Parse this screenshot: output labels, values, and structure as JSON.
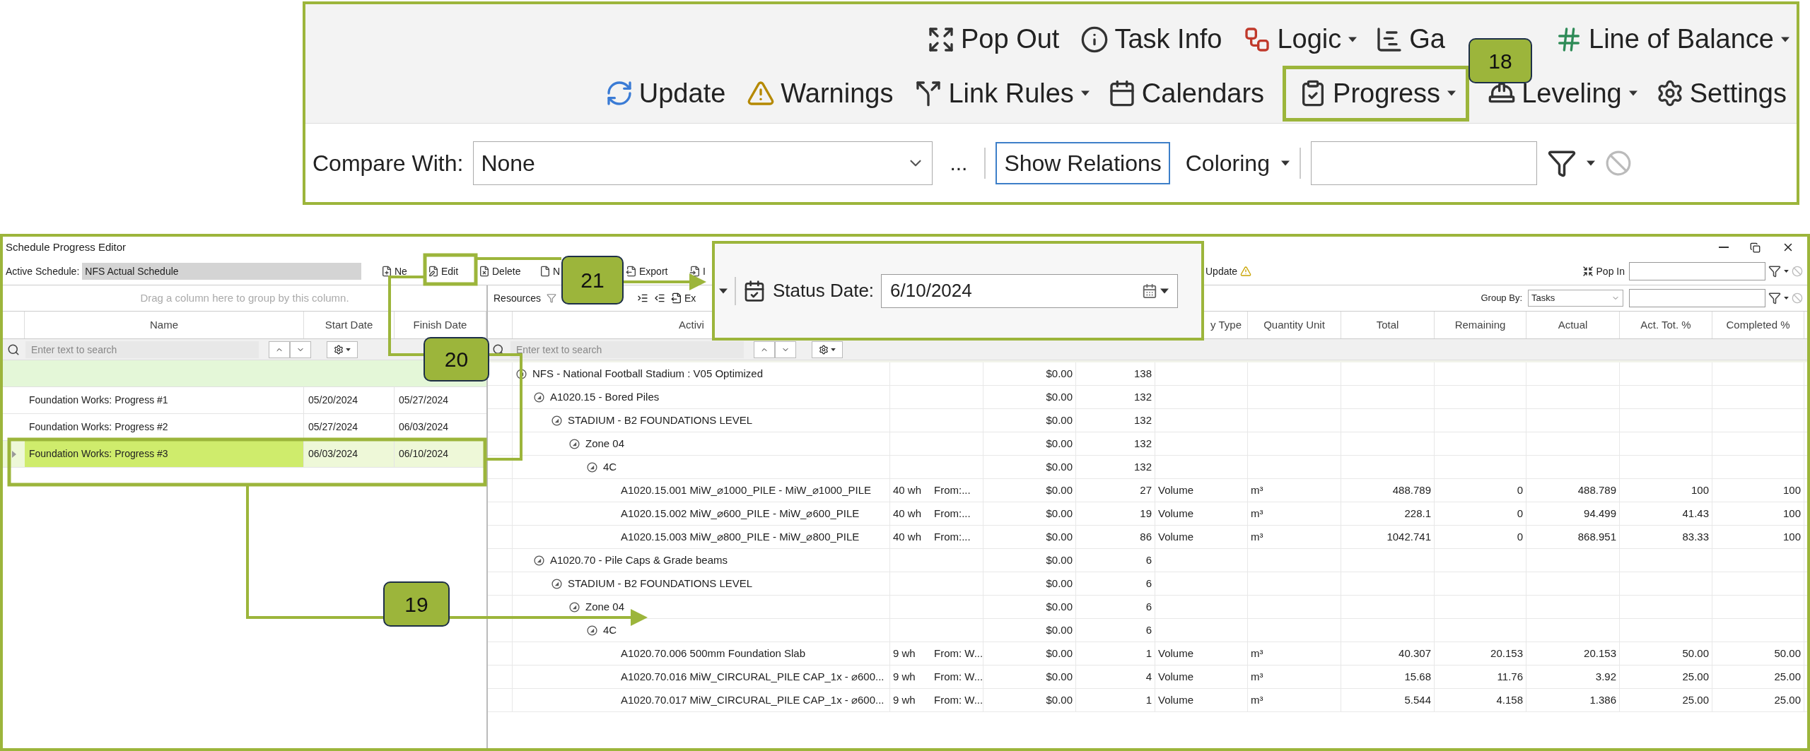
{
  "ribbon": {
    "row_1": [
      {
        "label": "Pop Out",
        "dropdown": false
      },
      {
        "label": "Task Info",
        "dropdown": false
      },
      {
        "label": "Logic",
        "dropdown": true
      },
      {
        "label": "Ga",
        "dropdown": false
      },
      {
        "label": "Line of Balance",
        "dropdown": true
      }
    ],
    "row_2": [
      {
        "label": "Update",
        "dropdown": false
      },
      {
        "label": "Warnings",
        "dropdown": false
      },
      {
        "label": "Link Rules",
        "dropdown": true
      },
      {
        "label": "Calendars",
        "dropdown": false
      },
      {
        "label": "Progress",
        "dropdown": true
      },
      {
        "label": "Leveling",
        "dropdown": true
      },
      {
        "label": "Settings",
        "dropdown": false
      }
    ],
    "compare_with": {
      "label": "Compare With:",
      "value": "None"
    },
    "more_button": "...",
    "show_relations_button": "Show Relations",
    "coloring_button": "Coloring"
  },
  "editor": {
    "title": "Schedule Progress Editor",
    "active_schedule": {
      "label": "Active Schedule:",
      "value": "NFS Actual Schedule"
    },
    "toolbar": [
      {
        "label": "Ne"
      },
      {
        "label": "Edit"
      },
      {
        "label": "Delete"
      },
      {
        "label": "N"
      },
      {
        "label": "Export"
      },
      {
        "label": "I"
      }
    ],
    "update_button": "Update",
    "pop_in_button": "Pop In"
  },
  "progress_list": {
    "group_hint": "Drag a column here to group by this column.",
    "columns": [
      "Name",
      "Start Date",
      "Finish Date"
    ],
    "search": {
      "placeholder": "Enter text to search"
    },
    "rows": [
      {
        "name": "Foundation Works: Progress #1",
        "start": "05/20/2024",
        "finish": "05/27/2024",
        "selected": false
      },
      {
        "name": "Foundation Works: Progress #2",
        "start": "05/27/2024",
        "finish": "06/03/2024",
        "selected": false
      },
      {
        "name": "Foundation Works: Progress #3",
        "start": "06/03/2024",
        "finish": "06/10/2024",
        "selected": true
      }
    ]
  },
  "activities": {
    "toolbar": {
      "resources": "Resources",
      "export": "Ex",
      "group_by": {
        "label": "Group By:",
        "value": "Tasks"
      }
    },
    "columns": {
      "activity": "Activi",
      "type": "y Type",
      "rest": [
        "Quantity Unit",
        "Total",
        "Remaining",
        "Actual",
        "Act. Tot. %",
        "Completed %"
      ]
    },
    "search": {
      "placeholder": "Enter text to search"
    },
    "rows": [
      {
        "name": "NFS - National Football Stadium : V05 Optimized",
        "cost": "$0.00",
        "count": "138",
        "expanded": true,
        "children": [
          {
            "name": "A1020.15 - Bored Piles",
            "cost": "$0.00",
            "count": "132",
            "expanded": true,
            "children": [
              {
                "name": "STADIUM - B2 FOUNDATIONS LEVEL",
                "cost": "$0.00",
                "count": "132",
                "expanded": true,
                "children": [
                  {
                    "name": "Zone 04",
                    "cost": "$0.00",
                    "count": "132",
                    "expanded": true,
                    "children": [
                      {
                        "name": "4C",
                        "cost": "$0.00",
                        "count": "132",
                        "expanded": true,
                        "children": [
                          {
                            "name": "A1020.15.001 MiW_⌀1000_PILE - MiW_⌀1000_PILE",
                            "work": "40 wh",
                            "from": "From:...",
                            "cost": "$0.00",
                            "count": "27",
                            "type": "Volume",
                            "unit": "m³",
                            "total": "488.789",
                            "remaining": "0",
                            "actual": "488.789",
                            "act_pct": "100",
                            "completed": "100"
                          },
                          {
                            "name": "A1020.15.002 MiW_⌀600_PILE - MiW_⌀600_PILE",
                            "work": "40 wh",
                            "from": "From:...",
                            "cost": "$0.00",
                            "count": "19",
                            "type": "Volume",
                            "unit": "m³",
                            "total": "228.1",
                            "remaining": "0",
                            "actual": "94.499",
                            "act_pct": "41.43",
                            "completed": "100"
                          },
                          {
                            "name": "A1020.15.003 MiW_⌀800_PILE - MiW_⌀800_PILE",
                            "work": "40 wh",
                            "from": "From:...",
                            "cost": "$0.00",
                            "count": "86",
                            "type": "Volume",
                            "unit": "m³",
                            "total": "1042.741",
                            "remaining": "0",
                            "actual": "868.951",
                            "act_pct": "83.33",
                            "completed": "100"
                          }
                        ]
                      }
                    ]
                  }
                ]
              }
            ]
          },
          {
            "name": "A1020.70 - Pile Caps & Grade beams",
            "cost": "$0.00",
            "count": "6",
            "expanded": true,
            "children": [
              {
                "name": "STADIUM - B2 FOUNDATIONS LEVEL",
                "cost": "$0.00",
                "count": "6",
                "expanded": true,
                "children": [
                  {
                    "name": "Zone 04",
                    "cost": "$0.00",
                    "count": "6",
                    "expanded": true,
                    "children": [
                      {
                        "name": "4C",
                        "cost": "$0.00",
                        "count": "6",
                        "expanded": true,
                        "children": [
                          {
                            "name": "A1020.70.006 500mm Foundation Slab",
                            "work": "9 wh",
                            "from": "From: W...",
                            "cost": "$0.00",
                            "count": "1",
                            "type": "Volume",
                            "unit": "m³",
                            "total": "40.307",
                            "remaining": "20.153",
                            "actual": "20.153",
                            "act_pct": "50.00",
                            "completed": "50.00"
                          },
                          {
                            "name": "A1020.70.016 MiW_CIRCURAL_PILE CAP_1x - ⌀600...",
                            "work": "9 wh",
                            "from": "From: W...",
                            "cost": "$0.00",
                            "count": "4",
                            "type": "Volume",
                            "unit": "m³",
                            "total": "15.68",
                            "remaining": "11.76",
                            "actual": "3.92",
                            "act_pct": "25.00",
                            "completed": "25.00"
                          },
                          {
                            "name": "A1020.70.017 MiW_CIRCURAL_PILE CAP_1x - ⌀600...",
                            "work": "9 wh",
                            "from": "From: W...",
                            "cost": "$0.00",
                            "count": "1",
                            "type": "Volume",
                            "unit": "m³",
                            "total": "5.544",
                            "remaining": "4.158",
                            "actual": "1.386",
                            "act_pct": "25.00",
                            "completed": "25.00"
                          }
                        ]
                      }
                    ]
                  }
                ]
              }
            ]
          }
        ]
      }
    ]
  },
  "status_date": {
    "label": "Status Date:",
    "value": "6/10/2024"
  },
  "callouts": [
    {
      "label": "18"
    },
    {
      "label": "19"
    },
    {
      "label": "20"
    },
    {
      "label": "21"
    }
  ]
}
